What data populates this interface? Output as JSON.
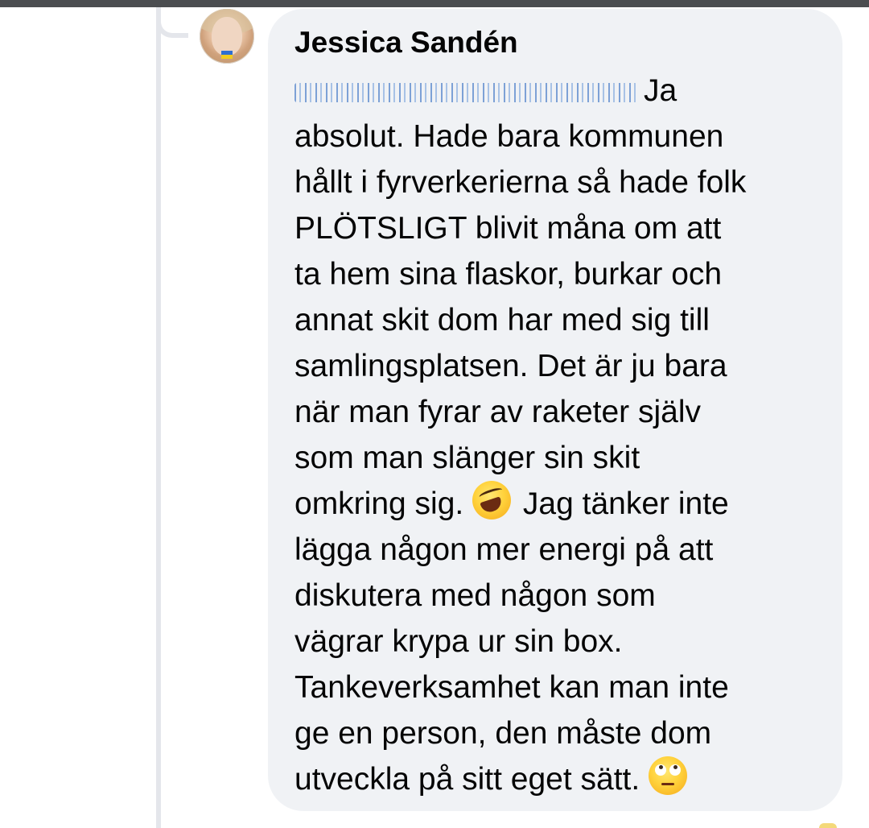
{
  "comment": {
    "author": "Jessica Sandén",
    "lines": [
      "Ja",
      "absolut. Hade bara kommunen",
      "hållt i fyrverkerierna så hade folk",
      "PLÖTSLIGT blivit måna om att",
      "ta hem sina flaskor, burkar och",
      "annat skit dom har med sig till",
      "samlingsplatsen. Det är ju bara",
      "när man fyrar av raketer själv",
      "som man slänger sin skit",
      "omkring sig.",
      "Jag tänker inte",
      "lägga någon mer energi på att",
      "diskutera med någon som",
      "vägrar krypa ur sin box.",
      "Tankeverksamhet kan man inte",
      "ge en person, den måste dom",
      "utveckla på sitt eget sätt."
    ],
    "emojis": {
      "laugh": "rolling-on-floor-laughing-emoji",
      "eye_roll": "face-with-rolling-eyes-emoji"
    }
  }
}
